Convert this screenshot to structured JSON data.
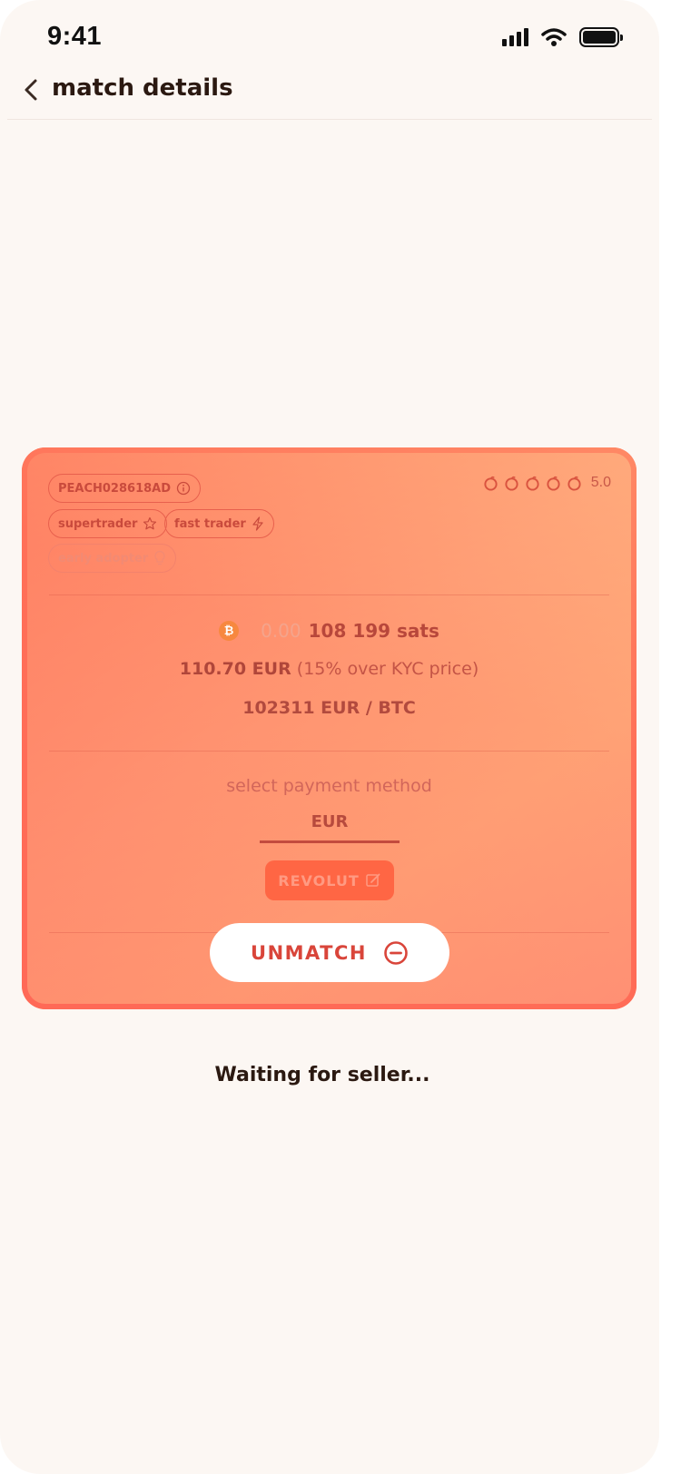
{
  "status_bar": {
    "time": "9:41"
  },
  "header": {
    "title": "match details"
  },
  "card": {
    "user_id": "PEACH028618AD",
    "badges": [
      {
        "label": "supertrader",
        "icon": "star-icon"
      },
      {
        "label": "fast trader",
        "icon": "lightning-icon"
      },
      {
        "label": "early adopter",
        "icon": "lightbulb-icon"
      }
    ],
    "rating": {
      "value": "5.0",
      "stars": 5
    },
    "amount_zero": "0.00",
    "amount_sats": "108 199 sats",
    "price": "110.70 EUR",
    "premium": "(15% over KYC price)",
    "rate": "102311 EUR / BTC",
    "payment_label": "select payment method",
    "currency": "EUR",
    "method": "REVOLUT",
    "unmatch_label": "UNMATCH"
  },
  "status_message": "Waiting for seller..."
}
